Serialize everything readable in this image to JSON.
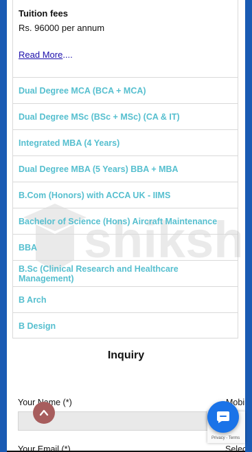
{
  "fees": {
    "title": "Tuition fees",
    "value": "Rs. 96000 per annum",
    "read_more": "Read More",
    "ellipsis": "...."
  },
  "courses": [
    "Dual Degree MCA (BCA + MCA)",
    "Dual Degree MSc (BSc + MSc) (CA & IT)",
    "Integrated MBA (4 Years)",
    "Dual Degree MBA (5 Years) BBA + MBA",
    "B.Com (Honors) with ACCA UK - IIMS",
    "Bachelor of Science (Hons) Aircraft Maintenance",
    "BBA",
    "B.Sc (Clinical Research and Healthcare Management)",
    "B Arch",
    "B Design"
  ],
  "watermark": {
    "text": "shiksha"
  },
  "inquiry": {
    "title": "Inquiry",
    "name_label": "Your Name (*)",
    "mobile_label": "Mobi",
    "email_label": "Your Email (*)",
    "select_label": "Selec"
  },
  "recaptcha": {
    "text": "Privacy - Terms"
  },
  "colors": {
    "course_link": "#56bfcf",
    "frame_blue": "#1a5bb4",
    "chat_button": "#1a73e8",
    "scroll_top_button": "#a75d5d"
  },
  "icons": {
    "scroll_top": "chevron-up-icon",
    "chat": "chat-bubble-icon"
  }
}
